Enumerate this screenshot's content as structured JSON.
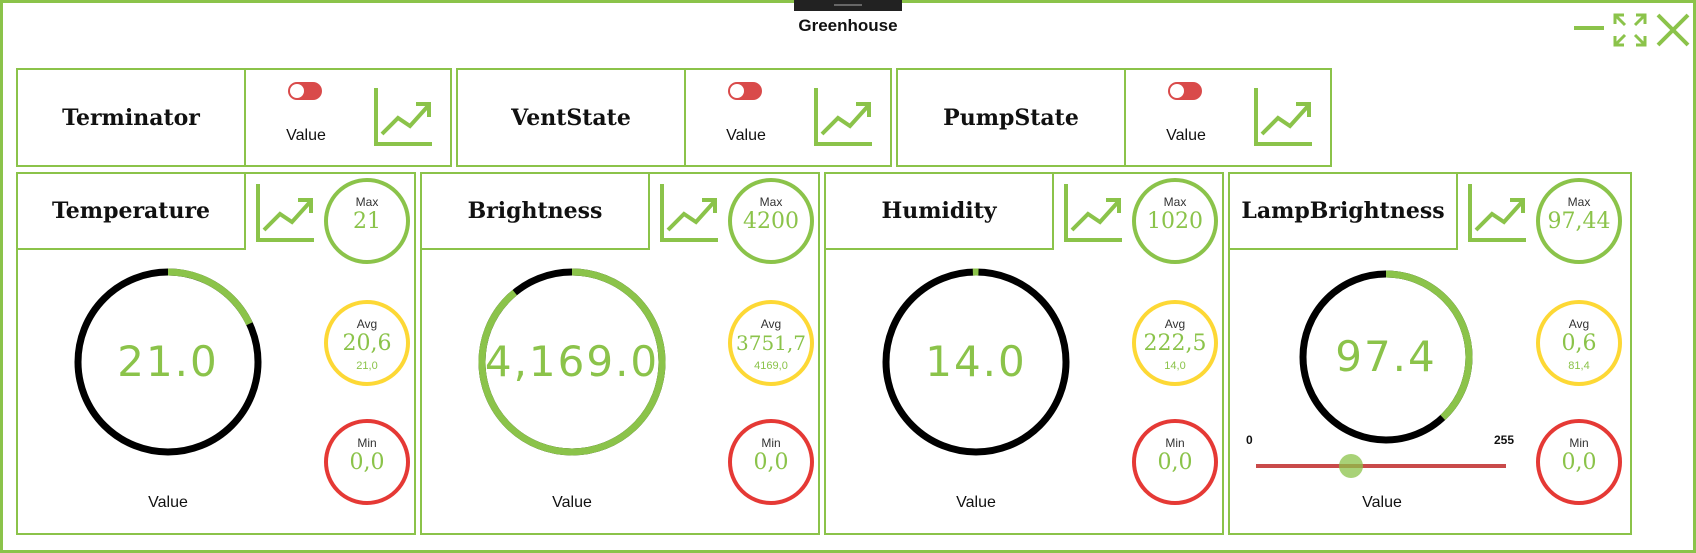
{
  "window": {
    "title": "Greenhouse"
  },
  "colors": {
    "accent": "#8bc34a",
    "avg": "#fdd835",
    "min": "#e53935",
    "toggle": "#d94a4a"
  },
  "switches": [
    {
      "name": "Terminator",
      "label": "Value"
    },
    {
      "name": "VentState",
      "label": "Value"
    },
    {
      "name": "PumpState",
      "label": "Value"
    }
  ],
  "sensors": [
    {
      "name": "Temperature",
      "value": "21.0",
      "label": "Value",
      "gauge_fraction": 0.18,
      "max": {
        "title": "Max",
        "value": "21"
      },
      "avg": {
        "title": "Avg",
        "value": "20,6",
        "sub": "21,0"
      },
      "min": {
        "title": "Min",
        "value": "0,0"
      }
    },
    {
      "name": "Brightness",
      "value": "4,169.0",
      "label": "Value",
      "gauge_fraction": 0.89,
      "max": {
        "title": "Max",
        "value": "4200"
      },
      "avg": {
        "title": "Avg",
        "value": "3751,7",
        "sub": "4169,0"
      },
      "min": {
        "title": "Min",
        "value": "0,0"
      }
    },
    {
      "name": "Humidity",
      "value": "14.0",
      "label": "Value",
      "gauge_fraction": 0.01,
      "max": {
        "title": "Max",
        "value": "1020"
      },
      "avg": {
        "title": "Avg",
        "value": "222,5",
        "sub": "14,0"
      },
      "min": {
        "title": "Min",
        "value": "0,0"
      }
    },
    {
      "name": "LampBrightness",
      "value": "97.4",
      "label": "Value",
      "gauge_fraction": 0.38,
      "slider": {
        "min": "0",
        "max": "255",
        "value": 97.4
      },
      "max": {
        "title": "Max",
        "value": "97,44"
      },
      "avg": {
        "title": "Avg",
        "value": "0,6",
        "sub": "81,4"
      },
      "min": {
        "title": "Min",
        "value": "0,0"
      }
    }
  ]
}
